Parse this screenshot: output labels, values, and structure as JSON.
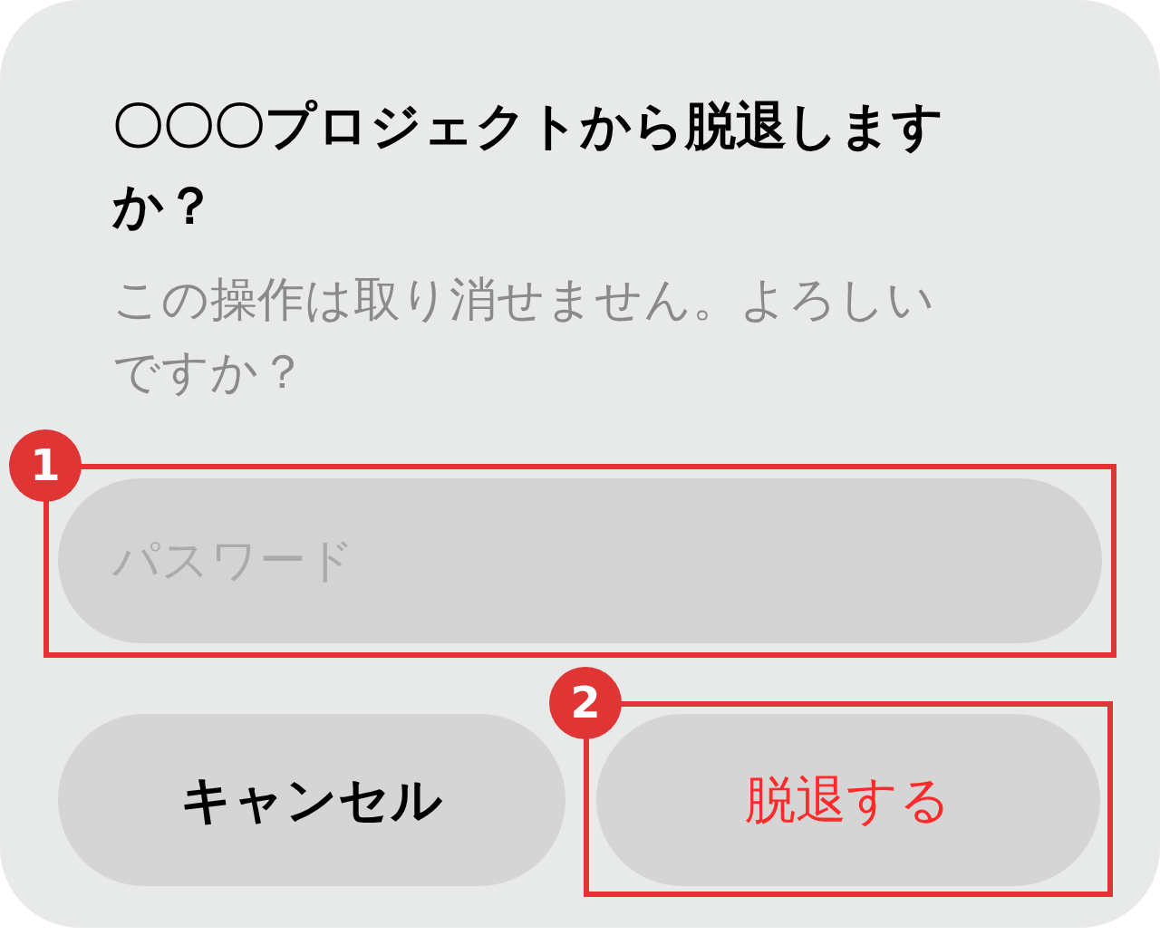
{
  "dialog": {
    "title": "〇〇〇プロジェクトから脱退しますか？",
    "message": "この操作は取り消せません。よろしいですか？",
    "password_field": {
      "placeholder": "パスワード"
    },
    "buttons": [
      {
        "label": "キャンセル",
        "kind": "cancel"
      },
      {
        "label": "脱退する",
        "kind": "destructive"
      }
    ]
  },
  "annotations": [
    {
      "label": "1"
    },
    {
      "label": "2"
    }
  ]
}
